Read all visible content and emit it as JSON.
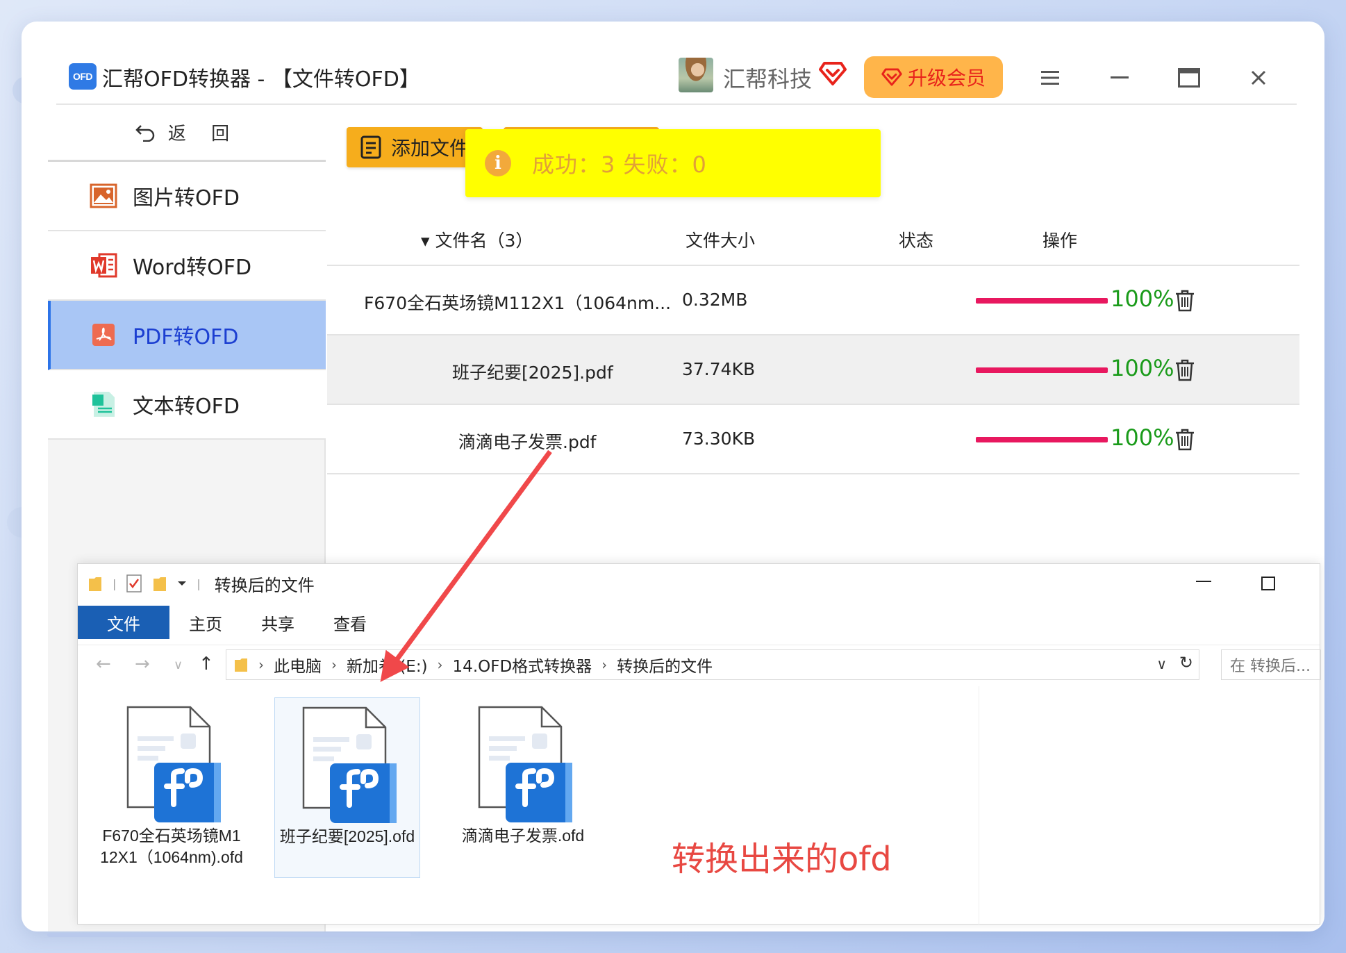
{
  "app": {
    "logo_text": "OFD",
    "title": "汇帮OFD转换器 - 【文件转OFD】",
    "company": "汇帮科技",
    "upgrade_label": "升级会员"
  },
  "sidebar": {
    "back_label": "返 回",
    "items": [
      {
        "label": "图片转OFD",
        "icon": "image-icon"
      },
      {
        "label": "Word转OFD",
        "icon": "word-icon"
      },
      {
        "label": "PDF转OFD",
        "icon": "pdf-icon",
        "active": true
      },
      {
        "label": "文本转OFD",
        "icon": "text-doc-icon"
      }
    ]
  },
  "toolbar": {
    "add_file_label": "添加文件"
  },
  "toast": {
    "text": "成功：3    失败：0"
  },
  "table": {
    "headers": {
      "name": "▾ 文件名（3）",
      "size": "文件大小",
      "status": "状态",
      "action": "操作"
    },
    "rows": [
      {
        "name": "F670全石英场镜M112X1（1064nm...",
        "size": "0.32MB",
        "progress": "100%"
      },
      {
        "name": "班子纪要[2025].pdf",
        "size": "37.74KB",
        "progress": "100%"
      },
      {
        "name": "滴滴电子发票.pdf",
        "size": "73.30KB",
        "progress": "100%"
      }
    ]
  },
  "explorer": {
    "title": "转换后的文件",
    "ribbon_tabs": [
      "文件",
      "主页",
      "共享",
      "查看"
    ],
    "breadcrumb": [
      "此电脑",
      "新加卷 (E:)",
      "14.OFD格式转换器",
      "转换后的文件"
    ],
    "search_placeholder": "在 转换后...",
    "files": [
      {
        "name": "F670全石英场镜M112X1（1064nm).ofd"
      },
      {
        "name": "班子纪要[2025].ofd",
        "selected": true
      },
      {
        "name": "滴滴电子发票.ofd"
      }
    ],
    "annotation": "转换出来的ofd"
  },
  "colors": {
    "accent_blue": "#2c73e8",
    "upgrade_bg": "#ffb54a",
    "add_button": "#f6ad1c",
    "toast_bg": "#ffff00",
    "progress": "#e8185f",
    "percent_text": "#1a9b1a",
    "annotation": "#e84842"
  }
}
